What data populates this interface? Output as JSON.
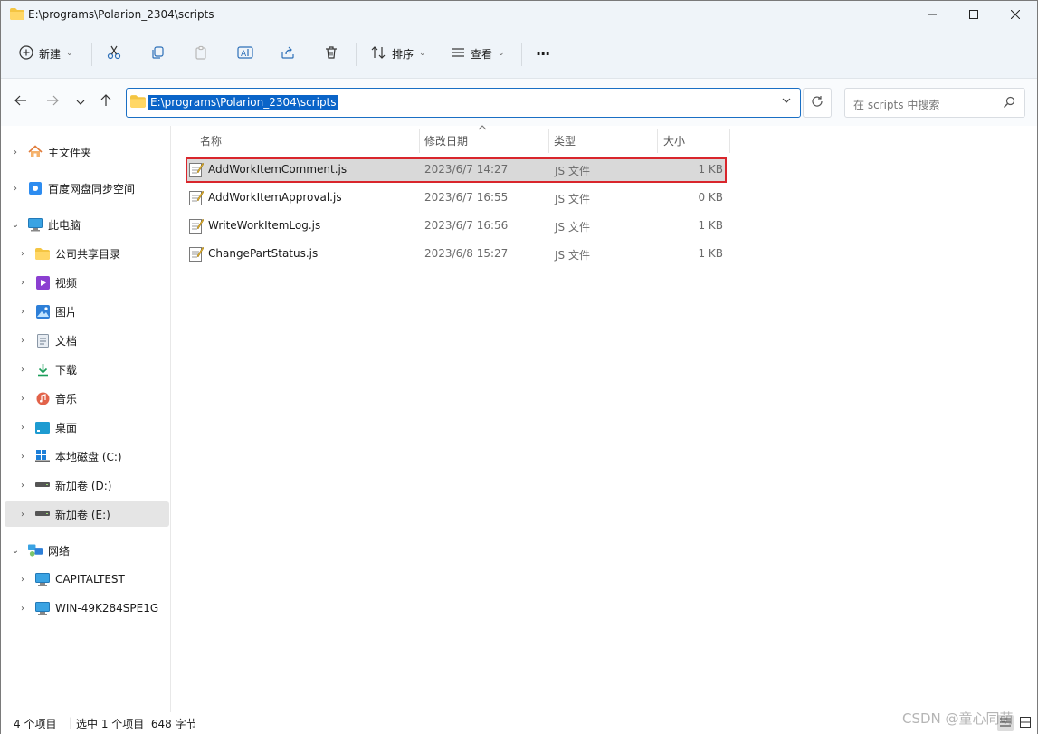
{
  "window": {
    "title": "E:\\programs\\Polarion_2304\\scripts"
  },
  "toolbar": {
    "new_label": "新建",
    "sort_label": "排序",
    "view_label": "查看",
    "more_label": "···"
  },
  "address": {
    "path": "E:\\programs\\Polarion_2304\\scripts"
  },
  "search": {
    "placeholder": "在 scripts 中搜索"
  },
  "sidebar": {
    "items": [
      {
        "label": "主文件夹"
      },
      {
        "label": "百度网盘同步空间"
      },
      {
        "label": "此电脑"
      },
      {
        "label": "公司共享目录"
      },
      {
        "label": "视频"
      },
      {
        "label": "图片"
      },
      {
        "label": "文档"
      },
      {
        "label": "下载"
      },
      {
        "label": "音乐"
      },
      {
        "label": "桌面"
      },
      {
        "label": "本地磁盘 (C:)"
      },
      {
        "label": "新加卷 (D:)"
      },
      {
        "label": "新加卷 (E:)"
      },
      {
        "label": "网络"
      },
      {
        "label": "CAPITALTEST"
      },
      {
        "label": "WIN-49K284SPE1G"
      }
    ]
  },
  "columns": {
    "name": "名称",
    "date": "修改日期",
    "type": "类型",
    "size": "大小"
  },
  "files": [
    {
      "name": "AddWorkItemComment.js",
      "date": "2023/6/7 14:27",
      "type": "JS 文件",
      "size": "1 KB"
    },
    {
      "name": "AddWorkItemApproval.js",
      "date": "2023/6/7 16:55",
      "type": "JS 文件",
      "size": "0 KB"
    },
    {
      "name": "WriteWorkItemLog.js",
      "date": "2023/6/7 16:56",
      "type": "JS 文件",
      "size": "1 KB"
    },
    {
      "name": "ChangePartStatus.js",
      "date": "2023/6/8 15:27",
      "type": "JS 文件",
      "size": "1 KB"
    }
  ],
  "status": {
    "count": "4 个项目",
    "selection": "选中 1 个项目  648 字节"
  },
  "watermark": "CSDN @童心同萌",
  "colors": {
    "accent": "#0a64c8",
    "selection_outline": "#d9262c",
    "folder": "#f4c542"
  }
}
